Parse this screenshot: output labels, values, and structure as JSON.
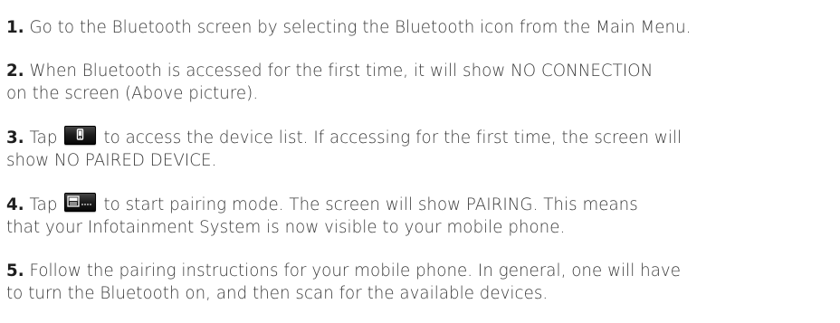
{
  "steps": [
    {
      "number": "1.",
      "lines": [
        "Go to the Bluetooth screen by selecting the Bluetooth icon from the Main Menu."
      ]
    },
    {
      "number": "2.",
      "lines": [
        "When Bluetooth is accessed for the first time, it will show NO CONNECTION",
        "on the screen (Above picture)."
      ]
    },
    {
      "number": "3.",
      "prefix": "Tap",
      "icon": "phone-device-icon",
      "suffix": "to access the device list. If accessing for the first time, the screen will",
      "line2": "show NO PAIRED DEVICE."
    },
    {
      "number": "4.",
      "prefix": "Tap",
      "icon": "pairing-new-icon",
      "suffix": "to start pairing mode. The screen will show PAIRING. This means",
      "line2": "that your Infotainment System is now visible to your mobile phone."
    },
    {
      "number": "5.",
      "lines": [
        "Follow the pairing instructions for your mobile phone. In general, one will have",
        "to turn the Bluetooth on, and then scan for the available devices."
      ]
    }
  ]
}
